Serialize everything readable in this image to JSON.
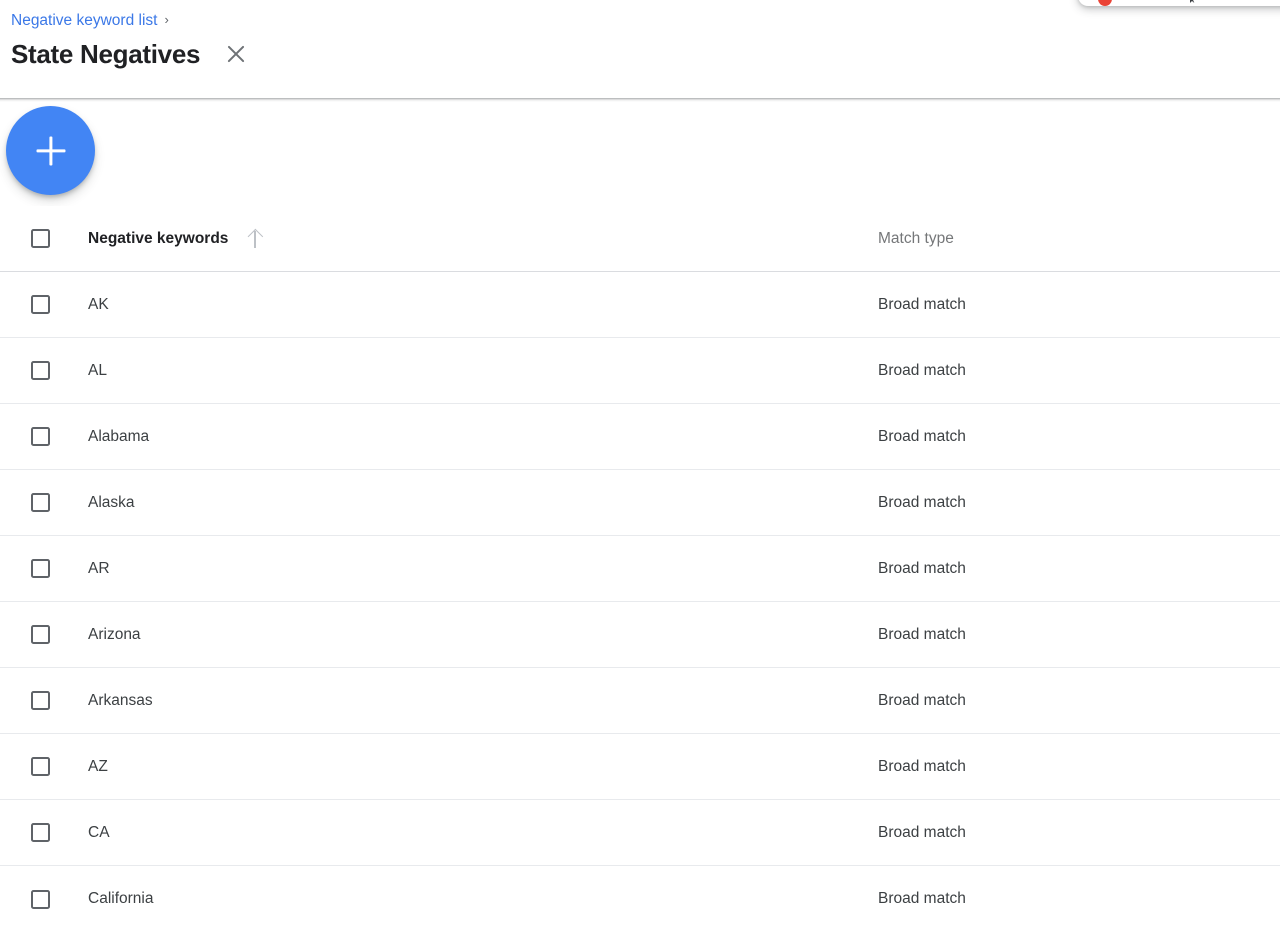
{
  "breadcrumb": {
    "parent_label": "Negative keyword list",
    "separator": "›"
  },
  "header": {
    "title": "State Negatives",
    "close_icon": "close-icon"
  },
  "toolbar": {
    "add_button_icon": "plus-icon",
    "add_button_label": "+"
  },
  "notification_card": {
    "red_dot_color": "#ea4335",
    "visible_fragment": true
  },
  "colors": {
    "link_blue": "#3b78e7",
    "fab_blue": "#4285f4",
    "text_primary": "#202124",
    "text_secondary": "#757779",
    "divider": "#e8eaed",
    "checkbox_border": "#5f6368",
    "sort_arrow": "#bdc1c6",
    "red_accent": "#ea4335"
  },
  "table": {
    "columns": [
      {
        "key": "checkbox",
        "label": "",
        "icon": "checkbox-icon"
      },
      {
        "key": "keyword",
        "label": "Negative keywords",
        "sort_icon": "arrow-up-icon",
        "sorted": "ascending"
      },
      {
        "key": "match_type",
        "label": "Match type"
      }
    ],
    "select_all_checked": false,
    "rows": [
      {
        "keyword": "AK",
        "match_type": "Broad match",
        "checked": false
      },
      {
        "keyword": "AL",
        "match_type": "Broad match",
        "checked": false
      },
      {
        "keyword": "Alabama",
        "match_type": "Broad match",
        "checked": false
      },
      {
        "keyword": "Alaska",
        "match_type": "Broad match",
        "checked": false
      },
      {
        "keyword": "AR",
        "match_type": "Broad match",
        "checked": false
      },
      {
        "keyword": "Arizona",
        "match_type": "Broad match",
        "checked": false
      },
      {
        "keyword": "Arkansas",
        "match_type": "Broad match",
        "checked": false
      },
      {
        "keyword": "AZ",
        "match_type": "Broad match",
        "checked": false
      },
      {
        "keyword": "CA",
        "match_type": "Broad match",
        "checked": false
      },
      {
        "keyword": "California",
        "match_type": "Broad match",
        "checked": false
      }
    ]
  }
}
